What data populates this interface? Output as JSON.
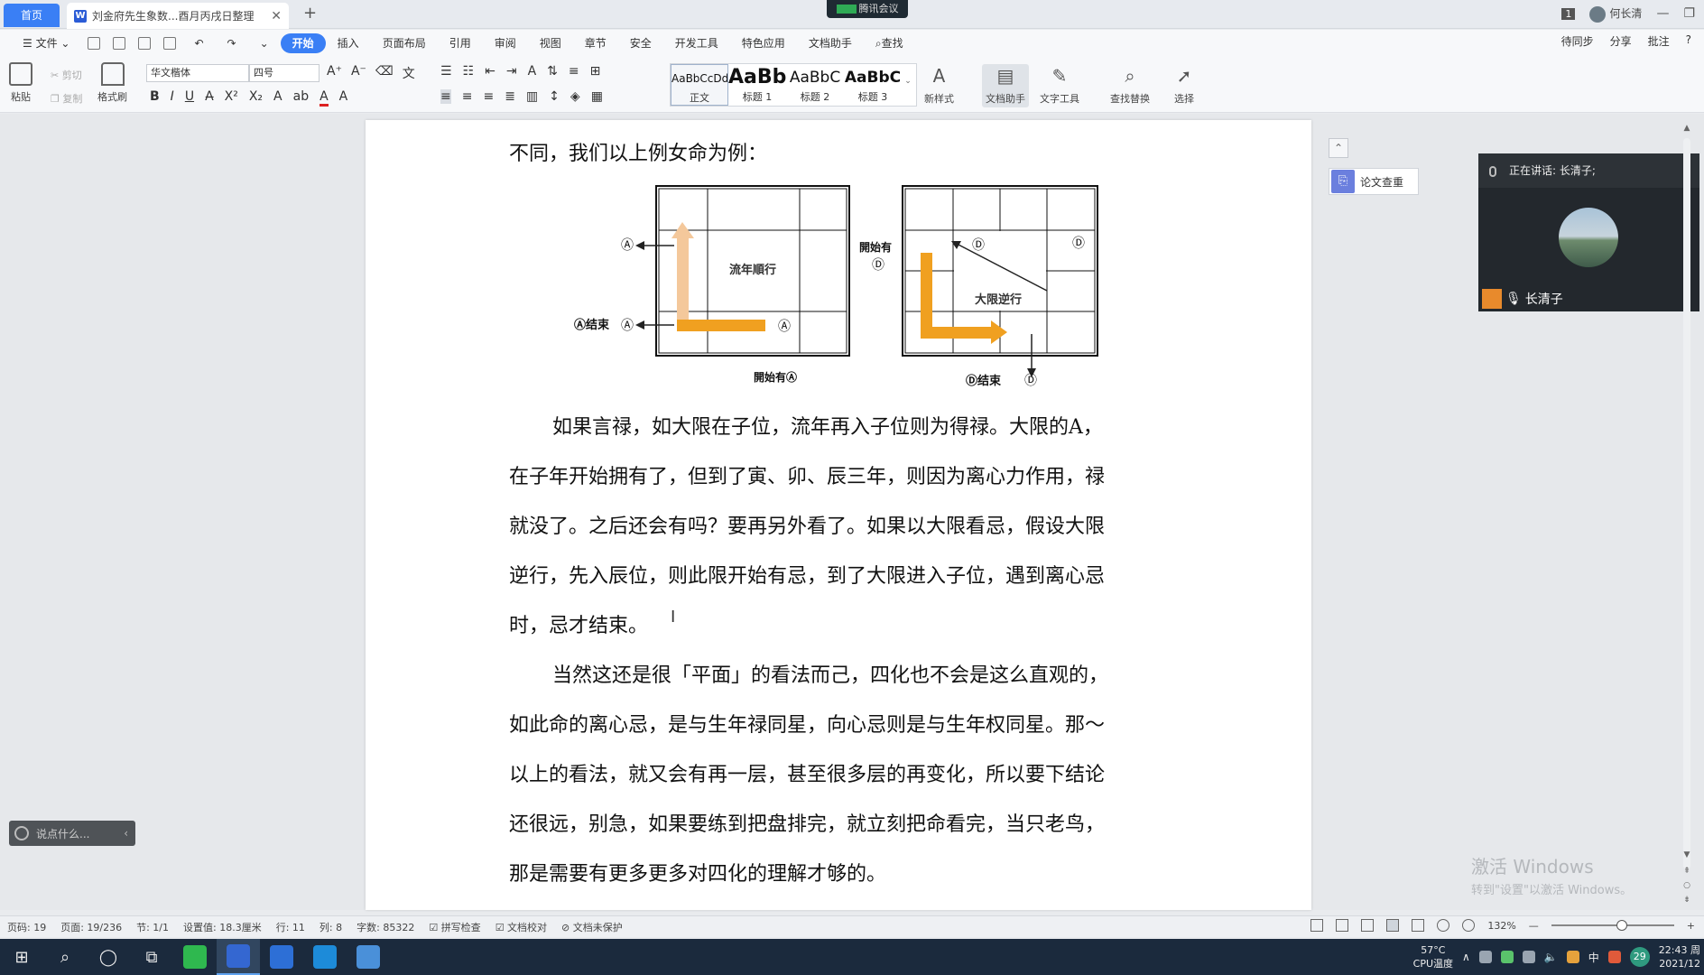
{
  "titlebar": {
    "home_tab": "首页",
    "doc_tab": "刘金府先生象数...酉月丙戌日整理",
    "doc_tab_icon": "W",
    "meeting_badge": "腾讯会议",
    "window_count": "1",
    "user_name": "何长清"
  },
  "menubar": {
    "file_label": "文件",
    "items": [
      "开始",
      "插入",
      "页面布局",
      "引用",
      "审阅",
      "视图",
      "章节",
      "安全",
      "开发工具",
      "特色应用",
      "文档助手"
    ],
    "search_label": "查找",
    "right_items": [
      "待同步",
      "分享",
      "批注",
      "?"
    ]
  },
  "ribbon": {
    "paste": "粘贴",
    "cut": "剪切",
    "copy": "复制",
    "format_painter": "格式刷",
    "font_name": "华文楷体",
    "font_size": "四号",
    "styles": [
      {
        "preview": "AaBbCcDd",
        "label": "正文"
      },
      {
        "preview": "AaBb",
        "label": "标题 1"
      },
      {
        "preview": "AaBbC",
        "label": "标题 2"
      },
      {
        "preview": "AaBbC",
        "label": "标题 3"
      }
    ],
    "new_style": "新样式",
    "doc_assistant": "文档助手",
    "text_tool": "文字工具",
    "find_replace": "查找替换",
    "select": "选择"
  },
  "document": {
    "line_top": "不同，我们以上例女命为例：",
    "para1": [
      "如果言禄，如大限在子位，流年再入子位则为得禄。大限的A，",
      "在子年开始拥有了，但到了寅、卯、辰三年，则因为离心力作用，禄",
      "就没了。之后还会有吗？要再另外看了。如果以大限看忌，假设大限",
      "逆行，先入辰位，则此限开始有忌，到了大限进入子位，遇到离心忌",
      "时，忌才结束。"
    ],
    "para2": [
      "当然这还是很「平面」的看法而己，四化也不会是这么直观的，",
      "如此命的离心忌，是与生年禄同星，向心忌则是与生年权同星。那～",
      "以上的看法，就又会有再一层，甚至很多层的再变化，所以要下结论",
      "还很远，别急，如果要练到把盘排完，就立刻把命看完，当只老鸟，",
      "那是需要有更多更多对四化的理解才够的。"
    ]
  },
  "figure": {
    "left_label": "流年順行",
    "left_end": "Ⓐ结束",
    "left_start": "開始有Ⓐ",
    "left_marker": "Ⓐ",
    "right_label": "大限逆行",
    "right_start_top": "開始有",
    "right_end": "Ⓓ结束",
    "right_marker": "Ⓓ"
  },
  "side": {
    "essay_check": "论文查重",
    "speaking": "正在讲话: 长清子;",
    "speaker_name": "长清子",
    "chat_placeholder": "说点什么...",
    "activate_line1": "激活 Windows",
    "activate_line2": "转到\"设置\"以激活 Windows。"
  },
  "statusbar": {
    "items": [
      "页码: 19",
      "页面: 19/236",
      "节: 1/1",
      "设置值: 18.3厘米",
      "行: 11",
      "列: 8",
      "字数: 85322",
      "拼写检查",
      "文档校对",
      "文档未保护"
    ],
    "zoom": "132%"
  },
  "taskbar": {
    "temp": "57°C",
    "temp_label": "CPU温度",
    "time": "22:43 周",
    "date": "2021/12",
    "ime": "中",
    "badge": "29"
  }
}
